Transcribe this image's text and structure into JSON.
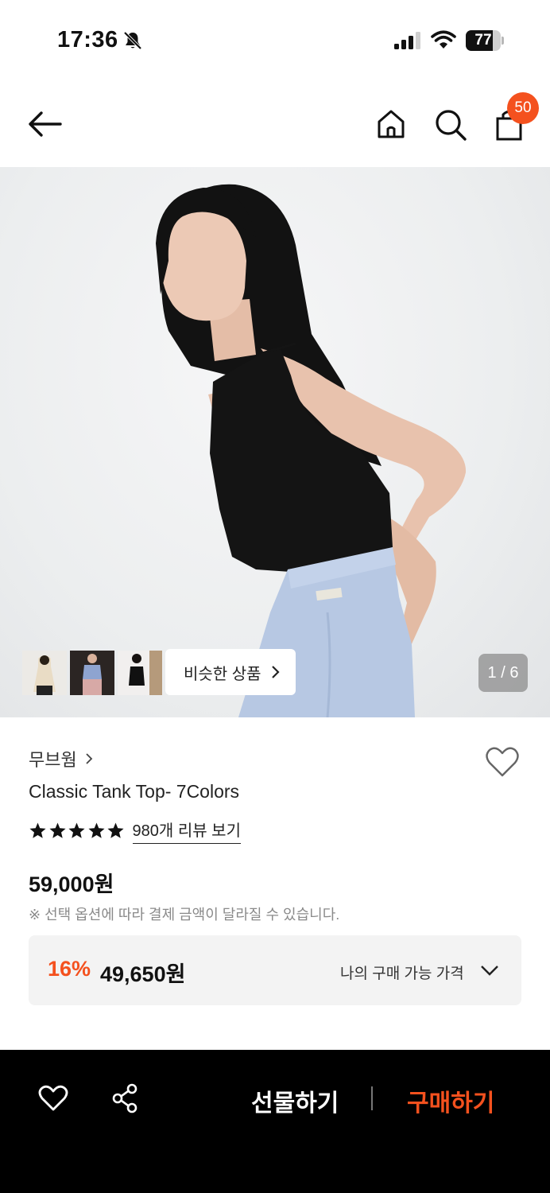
{
  "status_bar": {
    "time": "17:36",
    "battery": "77",
    "battery_level": 0.77
  },
  "header": {
    "cart_count": "50"
  },
  "gallery": {
    "similar_label": "비슷한 상품",
    "page_indicator": "1 / 6",
    "thumbnails": [
      "thumb-1",
      "thumb-2",
      "thumb-3"
    ]
  },
  "product": {
    "brand": "무브웜",
    "title": "Classic Tank Top- 7Colors",
    "rating_stars": 5,
    "review_link": "980개 리뷰 보기",
    "price": "59,000원",
    "price_note": "※ 선택 옵션에 따라 결제 금액이 달라질 수 있습니다.",
    "discount": {
      "percent": "16%",
      "price": "49,650원",
      "my_price_label": "나의 구매 가능 가격"
    }
  },
  "bottom_bar": {
    "gift_label": "선물하기",
    "buy_label": "구매하기"
  },
  "colors": {
    "accent": "#f4511e",
    "bottom_bar": "#000000"
  }
}
